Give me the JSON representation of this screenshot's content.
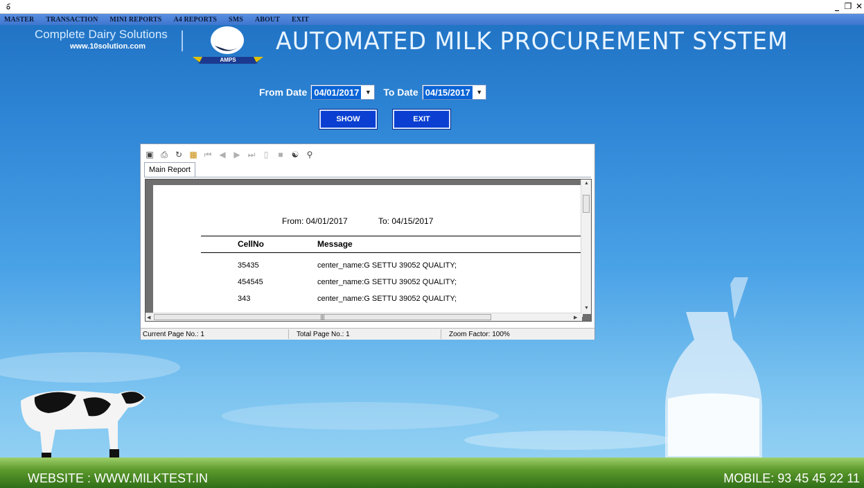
{
  "menu": [
    "MASTER",
    "TRANSACTION",
    "MINI REPORTS",
    "A4 REPORTS",
    "SMS",
    "ABOUT",
    "EXIT"
  ],
  "brand": {
    "tagline": "Complete Dairy Solutions",
    "website": "www.10solution.com",
    "logo_text": "AMPS",
    "app_title": "AUTOMATED MILK PROCUREMENT SYSTEM"
  },
  "filters": {
    "from_label": "From Date",
    "from_value": "04/01/2017",
    "to_label": "To Date",
    "to_value": "04/15/2017"
  },
  "buttons": {
    "show": "SHOW",
    "exit": "EXIT"
  },
  "viewer": {
    "tab_label": "Main Report",
    "report": {
      "from_text": "From: 04/01/2017",
      "to_text": "To: 04/15/2017",
      "columns": [
        "CellNo",
        "Message"
      ],
      "rows": [
        {
          "cellno": "35435",
          "message": "center_name:G SETTU 39052 QUALITY;"
        },
        {
          "cellno": "454545",
          "message": "center_name:G SETTU 39052 QUALITY;"
        },
        {
          "cellno": "343",
          "message": "center_name:G SETTU 39052 QUALITY;"
        }
      ]
    },
    "status": {
      "current_page": "Current Page No.: 1",
      "total_page": "Total Page No.: 1",
      "zoom": "Zoom Factor: 100%"
    },
    "toolbar_icons": [
      "export-icon",
      "print-icon",
      "refresh-icon",
      "group-tree-icon",
      "first-page-icon",
      "prev-page-icon",
      "next-page-icon",
      "last-page-icon",
      "goto-page-icon",
      "stop-icon",
      "search-icon",
      "zoom-icon"
    ]
  },
  "footer": {
    "website": "WEBSITE : WWW.MILKTEST.IN",
    "mobile": "MOBILE: 93 45 45 22 11"
  },
  "window_controls": [
    "_",
    "̅❐",
    "X"
  ]
}
